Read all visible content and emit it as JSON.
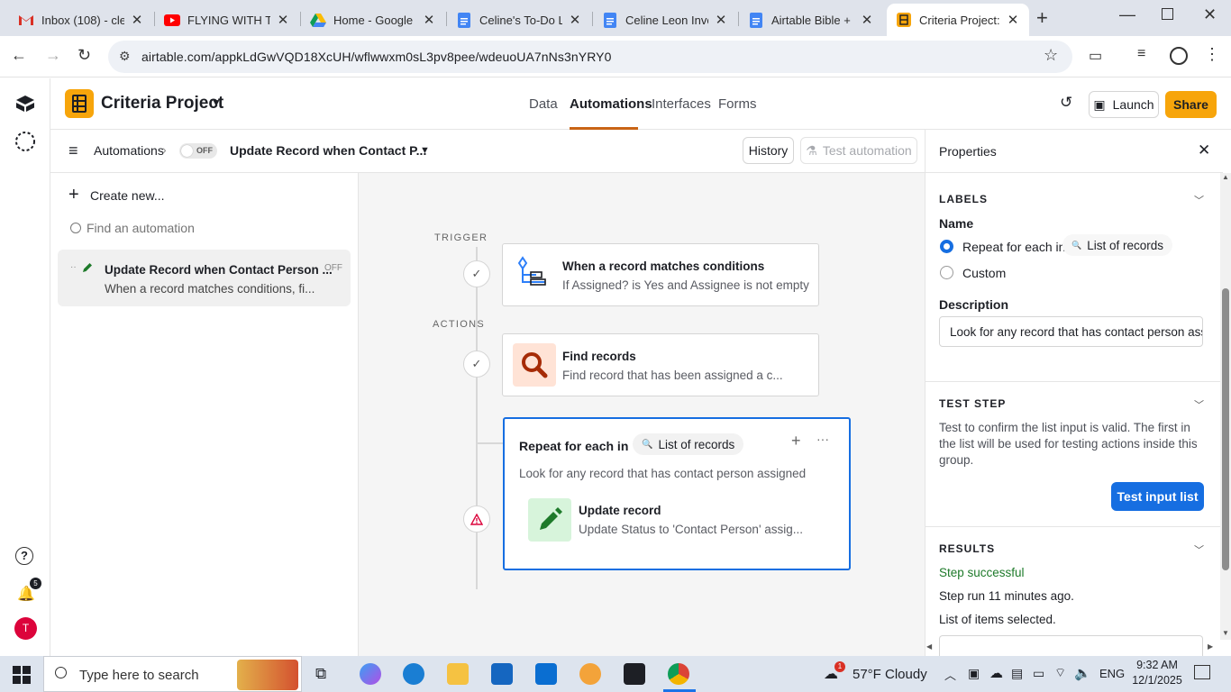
{
  "browser": {
    "tabs": [
      {
        "title": "Inbox (108) - cle",
        "icon": "gmail-icon",
        "color": "#d93025"
      },
      {
        "title": "FLYING WITH TH",
        "icon": "youtube-icon",
        "color": "#ff0000"
      },
      {
        "title": "Home - Google D",
        "icon": "google-drive-icon",
        "color": "#1a73e8"
      },
      {
        "title": "Celine's To-Do Li",
        "icon": "google-docs-icon",
        "color": "#4285f4"
      },
      {
        "title": "Celine Leon Invo",
        "icon": "google-docs-icon",
        "color": "#4285f4"
      },
      {
        "title": "Airtable Bible + C",
        "icon": "google-docs-icon",
        "color": "#4285f4"
      },
      {
        "title": "Criteria Project: I",
        "icon": "airtable-icon",
        "color": "#f7a50b"
      }
    ],
    "url": "airtable.com/appkLdGwVQD18XcUH/wflwwxm0sL3pv8pee/wdeuoUA7nNs3nYRY0"
  },
  "rail": {
    "notification_count": "5",
    "avatar_initial": "T"
  },
  "header": {
    "project_title": "Criteria Project",
    "nav": [
      "Data",
      "Automations",
      "Interfaces",
      "Forms"
    ],
    "active_nav": "Automations",
    "launch_label": "Launch",
    "share_label": "Share"
  },
  "subheader": {
    "breadcrumb": "Automations",
    "toggle_label": "OFF",
    "automation_name": "Update Record when Contact P...",
    "history_label": "History",
    "test_label": "Test automation"
  },
  "sidebar": {
    "create_label": "Create new...",
    "find_placeholder": "Find an automation",
    "automation": {
      "title": "Update Record when Contact Person ...",
      "subtitle": "When a record matches conditions, fi...",
      "status": "OFF"
    }
  },
  "canvas": {
    "trigger_label": "TRIGGER",
    "actions_label": "ACTIONS",
    "trigger": {
      "title": "When a record matches conditions",
      "desc": "If Assigned? is Yes and Assignee is not empty"
    },
    "find": {
      "title": "Find records",
      "desc": "Find record that has been assigned a c..."
    },
    "repeat": {
      "title": "Repeat for each in",
      "pill": "List of records",
      "desc": "Look for any record that has contact person assigned"
    },
    "update": {
      "title": "Update record",
      "desc": "Update Status to 'Contact Person' assig..."
    }
  },
  "properties": {
    "title": "Properties",
    "labels_heading": "LABELS",
    "name_label": "Name",
    "radio_repeat": "Repeat for each in",
    "radio_pill": "List of records",
    "radio_custom": "Custom",
    "description_label": "Description",
    "description_value": "Look for any record that has contact person ass",
    "test_heading": "TEST STEP",
    "test_desc": "Test to confirm the list input is valid. The first in the list will be used for testing actions inside this group.",
    "test_button": "Test input list",
    "results_heading": "RESULTS",
    "result_status": "Step successful",
    "result_time": "Step run 11 minutes ago.",
    "result_items": "List of items selected."
  },
  "taskbar": {
    "search_placeholder": "Type here to search",
    "weather_temp": "57°F",
    "weather_text": "Cloudy",
    "weather_badge": "1",
    "language": "ENG",
    "time": "9:32 AM",
    "date": "12/1/2025"
  },
  "colors": {
    "accent": "#166ee1",
    "brand": "#f7a50b",
    "success": "#1e7a2a"
  }
}
